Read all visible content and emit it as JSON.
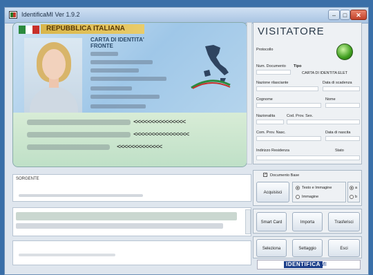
{
  "window": {
    "title": "IdentificaMI Ver 1.9.2",
    "buttons": {
      "minimize": "–",
      "maximize": "□",
      "close": "✕"
    }
  },
  "card": {
    "country": "REPUBBLICA ITALIANA",
    "doc_type_line1": "CARTA DI IDENTITA'",
    "doc_type_line2": "FRONTE",
    "mrz_line1": "<<<<<<<<<<<<<<<",
    "mrz_line2": "<<<<<<<<<<<<<<<<",
    "mrz_line3": "<<<<<<<<<<<<<"
  },
  "lower": {
    "label_top": "SORGENTE"
  },
  "visitor": {
    "heading": "VISITATORE",
    "protocol_label": "Protocollo",
    "doc_label": "Num. Documento",
    "type_label": "Tipo",
    "type_value": "CARTA DI IDENTITA ELET",
    "issued_label": "Nazione rilasciante",
    "expiry_label": "Data di scadenza",
    "surname_label": "Cognome",
    "name_label": "Nome",
    "nationality_label": "Nazionalita",
    "sex_label": "Cod. Prov. Sex.",
    "birth_label": "Com. Prov. Nasc.",
    "birthdate_label": "Data di nascita",
    "address_label": "Indirizzo Residenza",
    "state_label": "Stato"
  },
  "controls": {
    "doc_checkbox_label": "Documento Base",
    "acquire_button": "Acquisisci",
    "radio_text_image": "Testo e Immagine",
    "radio_image": "Immagine",
    "radio_a": "a",
    "radio_b": "b",
    "smartcard_button": "Smart Card",
    "import_button": "Importa",
    "transfer_button": "Trasferisci",
    "select_button": "Seleziona",
    "settings_button": "Settaggio",
    "exit_button": "Esci"
  },
  "logo": {
    "part1": "IDENTIFICA",
    "part2": "MI"
  }
}
